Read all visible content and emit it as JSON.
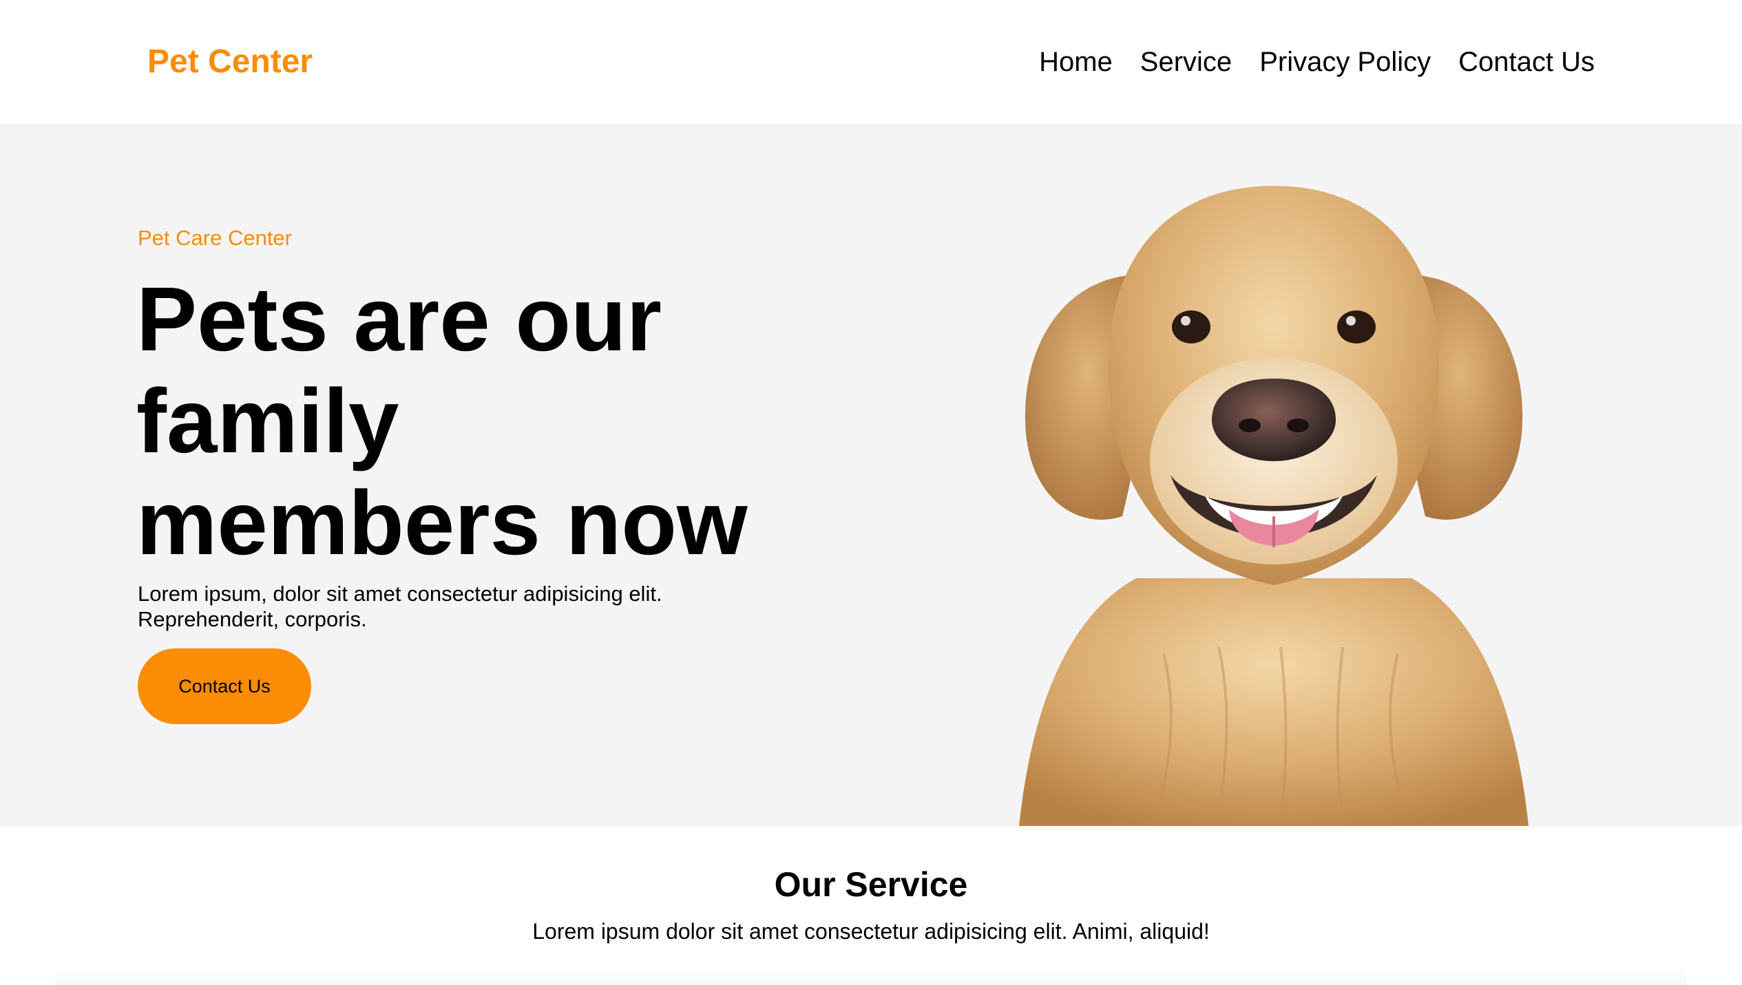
{
  "header": {
    "logo": "Pet Center",
    "nav": [
      {
        "label": "Home"
      },
      {
        "label": "Service"
      },
      {
        "label": "Privacy Policy"
      },
      {
        "label": "Contact Us"
      }
    ]
  },
  "hero": {
    "eyebrow": "Pet Care Center",
    "headline_line1": "Pets are our",
    "headline_line2": "family",
    "headline_line3": "members now",
    "lead": "Lorem ipsum, dolor sit amet consectetur adipisicing elit. Reprehenderit, corporis.",
    "cta_label": "Contact Us",
    "image_alt": "golden retriever"
  },
  "services": {
    "title": "Our Service",
    "subtitle": "Lorem ipsum dolor sit amet consectetur adipisicing elit. Animi, aliquid!"
  },
  "colors": {
    "accent": "#fb8c06",
    "hero_bg": "#f4f4f4",
    "text": "#000000"
  }
}
